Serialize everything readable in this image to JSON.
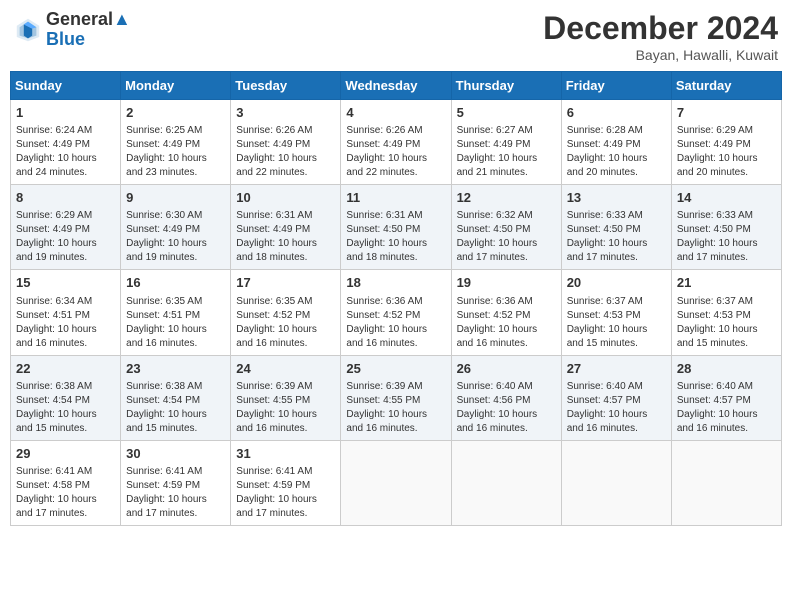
{
  "header": {
    "logo_line1": "General",
    "logo_line2": "Blue",
    "month": "December 2024",
    "location": "Bayan, Hawalli, Kuwait"
  },
  "days_of_week": [
    "Sunday",
    "Monday",
    "Tuesday",
    "Wednesday",
    "Thursday",
    "Friday",
    "Saturday"
  ],
  "weeks": [
    [
      {
        "day": "1",
        "sunrise": "6:24 AM",
        "sunset": "4:49 PM",
        "daylight": "10 hours and 24 minutes."
      },
      {
        "day": "2",
        "sunrise": "6:25 AM",
        "sunset": "4:49 PM",
        "daylight": "10 hours and 23 minutes."
      },
      {
        "day": "3",
        "sunrise": "6:26 AM",
        "sunset": "4:49 PM",
        "daylight": "10 hours and 22 minutes."
      },
      {
        "day": "4",
        "sunrise": "6:26 AM",
        "sunset": "4:49 PM",
        "daylight": "10 hours and 22 minutes."
      },
      {
        "day": "5",
        "sunrise": "6:27 AM",
        "sunset": "4:49 PM",
        "daylight": "10 hours and 21 minutes."
      },
      {
        "day": "6",
        "sunrise": "6:28 AM",
        "sunset": "4:49 PM",
        "daylight": "10 hours and 20 minutes."
      },
      {
        "day": "7",
        "sunrise": "6:29 AM",
        "sunset": "4:49 PM",
        "daylight": "10 hours and 20 minutes."
      }
    ],
    [
      {
        "day": "8",
        "sunrise": "6:29 AM",
        "sunset": "4:49 PM",
        "daylight": "10 hours and 19 minutes."
      },
      {
        "day": "9",
        "sunrise": "6:30 AM",
        "sunset": "4:49 PM",
        "daylight": "10 hours and 19 minutes."
      },
      {
        "day": "10",
        "sunrise": "6:31 AM",
        "sunset": "4:49 PM",
        "daylight": "10 hours and 18 minutes."
      },
      {
        "day": "11",
        "sunrise": "6:31 AM",
        "sunset": "4:50 PM",
        "daylight": "10 hours and 18 minutes."
      },
      {
        "day": "12",
        "sunrise": "6:32 AM",
        "sunset": "4:50 PM",
        "daylight": "10 hours and 17 minutes."
      },
      {
        "day": "13",
        "sunrise": "6:33 AM",
        "sunset": "4:50 PM",
        "daylight": "10 hours and 17 minutes."
      },
      {
        "day": "14",
        "sunrise": "6:33 AM",
        "sunset": "4:50 PM",
        "daylight": "10 hours and 17 minutes."
      }
    ],
    [
      {
        "day": "15",
        "sunrise": "6:34 AM",
        "sunset": "4:51 PM",
        "daylight": "10 hours and 16 minutes."
      },
      {
        "day": "16",
        "sunrise": "6:35 AM",
        "sunset": "4:51 PM",
        "daylight": "10 hours and 16 minutes."
      },
      {
        "day": "17",
        "sunrise": "6:35 AM",
        "sunset": "4:52 PM",
        "daylight": "10 hours and 16 minutes."
      },
      {
        "day": "18",
        "sunrise": "6:36 AM",
        "sunset": "4:52 PM",
        "daylight": "10 hours and 16 minutes."
      },
      {
        "day": "19",
        "sunrise": "6:36 AM",
        "sunset": "4:52 PM",
        "daylight": "10 hours and 16 minutes."
      },
      {
        "day": "20",
        "sunrise": "6:37 AM",
        "sunset": "4:53 PM",
        "daylight": "10 hours and 15 minutes."
      },
      {
        "day": "21",
        "sunrise": "6:37 AM",
        "sunset": "4:53 PM",
        "daylight": "10 hours and 15 minutes."
      }
    ],
    [
      {
        "day": "22",
        "sunrise": "6:38 AM",
        "sunset": "4:54 PM",
        "daylight": "10 hours and 15 minutes."
      },
      {
        "day": "23",
        "sunrise": "6:38 AM",
        "sunset": "4:54 PM",
        "daylight": "10 hours and 15 minutes."
      },
      {
        "day": "24",
        "sunrise": "6:39 AM",
        "sunset": "4:55 PM",
        "daylight": "10 hours and 16 minutes."
      },
      {
        "day": "25",
        "sunrise": "6:39 AM",
        "sunset": "4:55 PM",
        "daylight": "10 hours and 16 minutes."
      },
      {
        "day": "26",
        "sunrise": "6:40 AM",
        "sunset": "4:56 PM",
        "daylight": "10 hours and 16 minutes."
      },
      {
        "day": "27",
        "sunrise": "6:40 AM",
        "sunset": "4:57 PM",
        "daylight": "10 hours and 16 minutes."
      },
      {
        "day": "28",
        "sunrise": "6:40 AM",
        "sunset": "4:57 PM",
        "daylight": "10 hours and 16 minutes."
      }
    ],
    [
      {
        "day": "29",
        "sunrise": "6:41 AM",
        "sunset": "4:58 PM",
        "daylight": "10 hours and 17 minutes."
      },
      {
        "day": "30",
        "sunrise": "6:41 AM",
        "sunset": "4:59 PM",
        "daylight": "10 hours and 17 minutes."
      },
      {
        "day": "31",
        "sunrise": "6:41 AM",
        "sunset": "4:59 PM",
        "daylight": "10 hours and 17 minutes."
      },
      null,
      null,
      null,
      null
    ]
  ]
}
